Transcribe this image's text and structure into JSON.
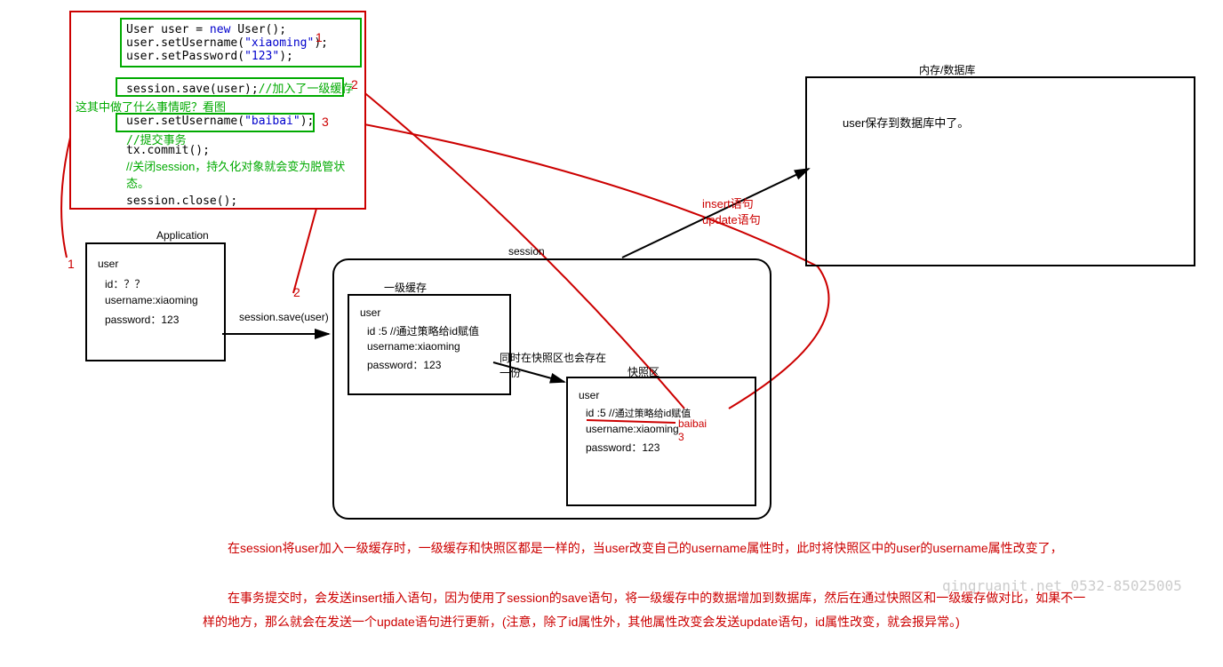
{
  "code": {
    "line1a": "User user = ",
    "line1b": "new",
    "line1c": " User();",
    "line2a": "user.setUsername(",
    "line2b": "\"xiaoming\"",
    "line2c": ");",
    "line3a": "user.setPassword(",
    "line3b": "\"123\"",
    "line3c": ");",
    "line4a": "session.save(user);",
    "line4b": "//加入了一级缓存",
    "note": "这其中做了什么事情呢？看图",
    "line5a": "user.setUsername(",
    "line5b": "\"baibai\"",
    "line5c": ");",
    "c1": "//提交事务",
    "line6": "tx.commit();",
    "c2": "//关闭session，持久化对象就会变为脱管状态。",
    "line7": "session.close();",
    "mark1": "1",
    "mark2": "2",
    "mark3": "3"
  },
  "app": {
    "title": "Application",
    "f1": "user",
    "f2": "id：？？",
    "f3": "username:xiaoming",
    "f4": "password：123",
    "arrowLabel": "session.save(user)"
  },
  "session": {
    "title": "session",
    "cacheTitle": "一级缓存",
    "cache": {
      "f1": "user",
      "f2": "id :5 //通过策略给id赋值",
      "f3": "username:xiaoming",
      "f4": "password：123"
    },
    "midNote": "同时在快照区也会存在一份",
    "snapTitle": "快照区",
    "snap": {
      "f1": "user",
      "f2": "id :5 //",
      "f2b": "通过策略给id赋值",
      "f3": "username:xiaoming",
      "f4": "password：123"
    },
    "baibai": "baibai",
    "num3": "3"
  },
  "db": {
    "title": "内存/数据库",
    "content": "user保存到数据库中了。",
    "line1": "insert语句",
    "line2": "update语句"
  },
  "leftNums": {
    "n1": "1",
    "n2": "2"
  },
  "paras": {
    "p1": "　　在session将user加入一级缓存时，一级缓存和快照区都是一样的，当user改变自己的username属性时，此时将快照区中的user的username属性改变了，",
    "p2": "　　在事务提交时，会发送insert插入语句，因为使用了session的save语句，将一级缓存中的数据增加到数据库，然后在通过快照区和一级缓存做对比，如果不一样的地方，那么就会在发送一个update语句进行更新，(注意，除了id属性外，其他属性改变会发送update语句，id属性改变，就会报异常。)"
  },
  "watermark": "qingruanit.net 0532-85025005"
}
